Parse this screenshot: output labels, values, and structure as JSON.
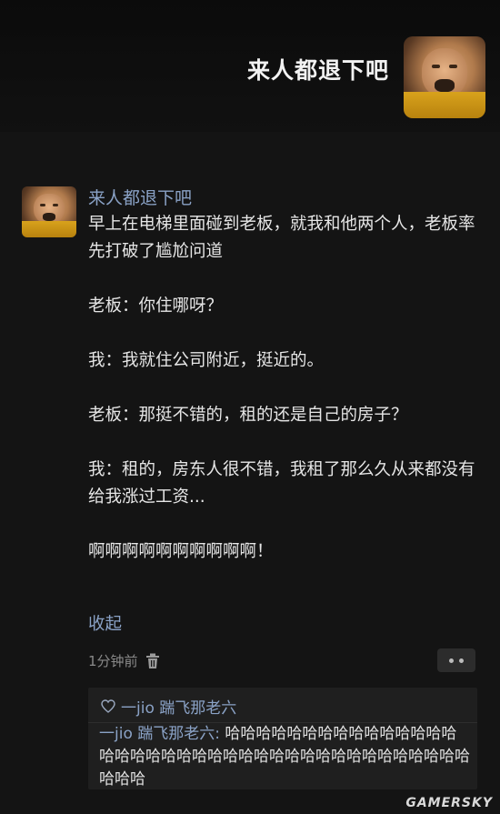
{
  "cover": {
    "title": "来人都退下吧"
  },
  "post": {
    "username": "来人都退下吧",
    "paragraphs": [
      "早上在电梯里面碰到老板，就我和他两个人，老板率先打破了尴尬问道",
      "老板：你住哪呀？",
      "我：我就住公司附近，挺近的。",
      "老板：那挺不错的，租的还是自己的房子？",
      "我：租的，房东人很不错，我租了那么久从来都没有给我涨过工资...",
      "啊啊啊啊啊啊啊啊啊啊！"
    ],
    "collapse_label": "收起",
    "time": "1分钟前"
  },
  "comments": {
    "likes": "一jio 踹飞那老六",
    "items": [
      {
        "author": "一jio 踹飞那老六:",
        "text": " 哈哈哈哈哈哈哈哈哈哈哈哈哈哈哈哈哈哈哈哈哈哈哈哈哈哈哈哈哈哈哈哈哈哈哈哈哈哈哈哈哈哈"
      }
    ]
  },
  "watermark": "GAMERSKY",
  "icons": {
    "like": "heart-outline-icon",
    "delete": "trash-icon",
    "more": "more-dots-icon"
  },
  "colors": {
    "background": "#141414",
    "link": "#8aa2c6",
    "text": "#e6e6e6"
  }
}
